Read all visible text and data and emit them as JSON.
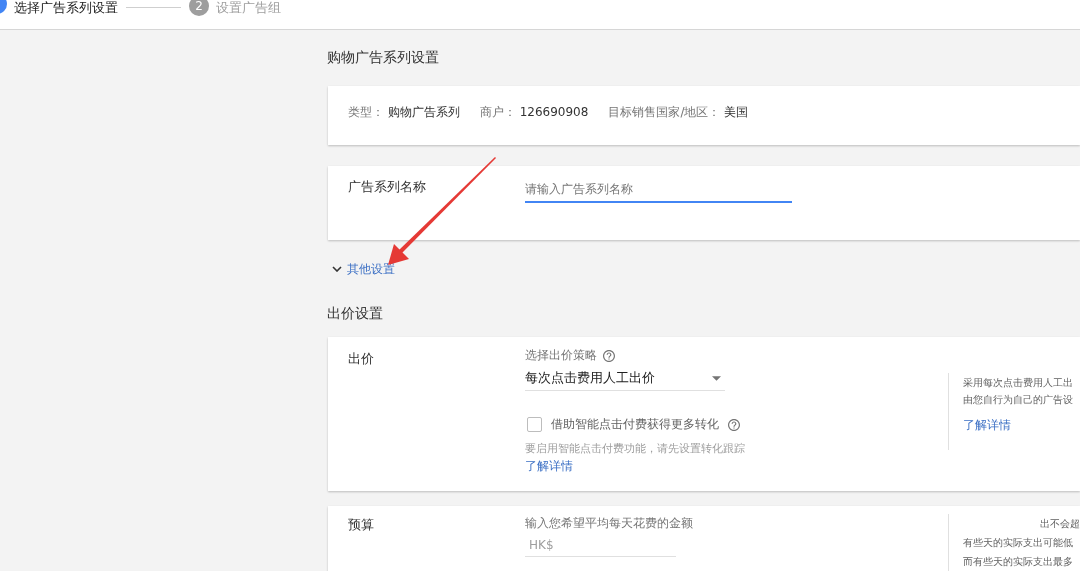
{
  "stepper": {
    "steps": [
      {
        "label": "选择广告系列设置",
        "selected": true
      },
      {
        "number": "2",
        "label": "设置广告组",
        "selected": false
      }
    ]
  },
  "campaign_section": {
    "title": "购物广告系列设置",
    "summary": [
      {
        "label": "类型：",
        "value": "购物广告系列"
      },
      {
        "label": "商户：",
        "value": "126690908"
      },
      {
        "label": "目标销售国家/地区：",
        "value": "美国"
      }
    ],
    "name_field": {
      "label": "广告系列名称",
      "placeholder": "请输入广告系列名称",
      "focused": true
    },
    "more_settings": {
      "label": "其他设置",
      "expanded": false
    }
  },
  "bidding_section": {
    "title": "出价设置",
    "bid_card": {
      "label": "出价",
      "strategy_label": "选择出价策略",
      "strategy_value": "每次点击费用人工出价",
      "checkbox": {
        "label": "借助智能点击付费获得更多转化",
        "checked": false
      },
      "hint": "要启用智能点击付费功能，请先设置转化跟踪",
      "hint_link": "了解详情",
      "side_text": [
        "采用每次点击费用人工出",
        "由您自行为自己的广告设"
      ],
      "side_link": "了解详情"
    },
    "budget_card": {
      "label": "预算",
      "prompt": "输入您希望平均每天花费的金额",
      "placeholder": "HK$",
      "side_text": [
        {
          "text": "出不会超",
          "partial": true
        },
        {
          "text": "有些天的实际支出可能低",
          "partial": false
        },
        {
          "text": "而有些天的实际支出最多",
          "partial": false
        }
      ]
    }
  }
}
